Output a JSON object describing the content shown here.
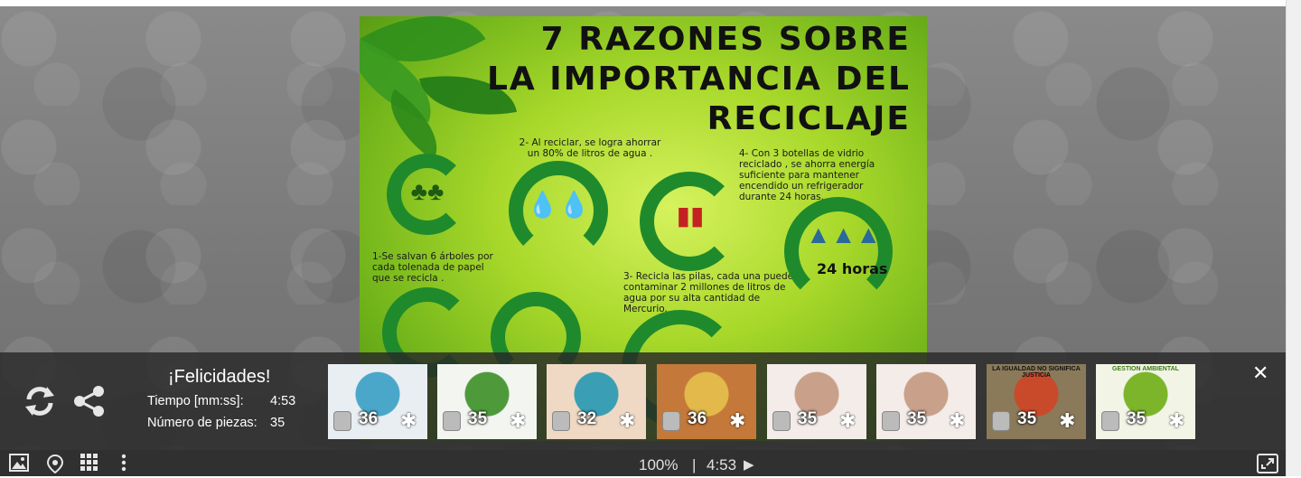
{
  "puzzle": {
    "title_lines": [
      "7 RAZONES SOBRE",
      "LA IMPORTANCIA DEL",
      "RECICLAJE"
    ],
    "reasons": [
      "1-Se salvan 6 árboles por cada tolenada de papel que se recicla .",
      "2- Al reciclar, se logra ahorrar un 80% de litros de agua .",
      "3- Recicla las pilas, cada una puede contaminar 2 millones de litros de agua por su alta cantidad de Mercurio.",
      "4- Con 3 botellas de vidrio reciclado , se ahorra energía suficiente para mantener encendido un refrigerador durante 24 horas."
    ],
    "hours_label": "24 horas"
  },
  "completion": {
    "heading": "¡Felicidades!",
    "time_label": "Tiempo [mm:ss]:",
    "time_value": "4:53",
    "pieces_label": "Número de piezas:",
    "pieces_value": "35"
  },
  "thumbnails": [
    {
      "pieces": "36",
      "bg": "#e9eef2",
      "accent": "#4aa7c9"
    },
    {
      "pieces": "35",
      "bg": "#f3f6f0",
      "accent": "#4e9a3a"
    },
    {
      "pieces": "32",
      "bg": "#f0d9c4",
      "accent": "#3a9fb5"
    },
    {
      "pieces": "36",
      "bg": "#c4793a",
      "accent": "#e2b94a"
    },
    {
      "pieces": "35",
      "bg": "#f3ece8",
      "accent": "#c9a08a"
    },
    {
      "pieces": "35",
      "bg": "#f3ece8",
      "accent": "#c9a08a"
    },
    {
      "pieces": "35",
      "bg": "#8a7a5a",
      "accent": "#c94a2a",
      "caption": "LA IGUALDAD NO SIGNIFICA JUSTICIA"
    },
    {
      "pieces": "35",
      "bg": "#f2f5e6",
      "accent": "#7cb42a",
      "caption": "GESTION AMBIENTAL"
    }
  ],
  "status": {
    "zoom": "100%",
    "separator": "|",
    "timer": "4:53"
  },
  "icons": {
    "restart": "refresh-icon",
    "share": "share-icon",
    "close": "close-icon",
    "image": "image-icon",
    "location": "locate-icon",
    "grid": "grid-icon",
    "more": "more-vertical-icon",
    "play": "play-icon",
    "fullscreen": "fullscreen-icon"
  }
}
